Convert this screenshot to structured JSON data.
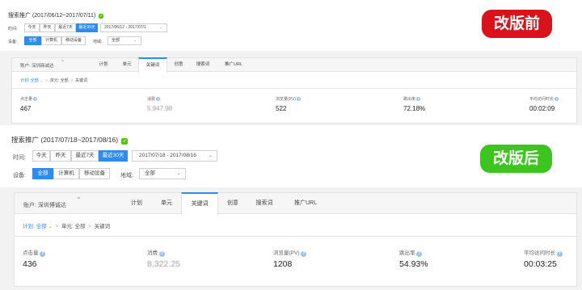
{
  "before": {
    "badge": "改版前",
    "badge_color": "#d9121b",
    "title": "搜索推广 (2017/06/12~2017/07/11)",
    "time_label": "时间:",
    "time_buttons": [
      "今天",
      "昨天",
      "最近7天",
      "最近30天"
    ],
    "date_range": "2017/06/12 - 2017/07/1",
    "device_label": "设备:",
    "device_buttons": [
      "全部",
      "计算机",
      "移动设备"
    ],
    "region_label": "地域:",
    "region_value": "全部",
    "account": "账户: 深圳商诚达",
    "tabs": [
      "计划",
      "单元",
      "关键词",
      "创意",
      "搜索词",
      "推广URL"
    ],
    "crumbs": {
      "plan": "计划: 全部",
      "unit": "单元: 全部",
      "current": "关键词"
    },
    "metrics": [
      {
        "label": "点击量",
        "value": "467"
      },
      {
        "label": "消费",
        "value": "5,947.98"
      },
      {
        "label": "浏览量(PV)",
        "value": "522"
      },
      {
        "label": "跳出率",
        "value": "72.18%"
      },
      {
        "label": "平均访问时长",
        "value": "00:02:09"
      }
    ]
  },
  "after": {
    "badge": "改版后",
    "badge_color": "#3cc51f",
    "title": "搜索推广 (2017/07/18~2017/08/16)",
    "time_label": "时间:",
    "time_buttons": [
      "今天",
      "昨天",
      "最近7天",
      "最近30天"
    ],
    "date_range": "2017/07/18 - 2017/08/16",
    "device_label": "设备:",
    "device_buttons": [
      "全部",
      "计算机",
      "移动设备"
    ],
    "region_label": "地域:",
    "region_value": "全部",
    "account": "账户: 深圳博诚达",
    "tabs": [
      "计划",
      "单元",
      "关键词",
      "创意",
      "搜索词",
      "推广URL"
    ],
    "crumbs": {
      "plan": "计划: 全部",
      "unit": "单元: 全部",
      "current": "关键词"
    },
    "metrics": [
      {
        "label": "点击量",
        "value": "436"
      },
      {
        "label": "消费",
        "value": "8,322.25"
      },
      {
        "label": "浏览量(PV)",
        "value": "1208"
      },
      {
        "label": "跳出率",
        "value": "54.93%"
      },
      {
        "label": "平均访问时长",
        "value": "00:03:25"
      }
    ]
  },
  "icons": {
    "info": "info-circle-icon",
    "chevron": "chevron-down-icon",
    "crumb_sep": "chevron-right-icon",
    "checkmark": "check-badge-icon"
  }
}
